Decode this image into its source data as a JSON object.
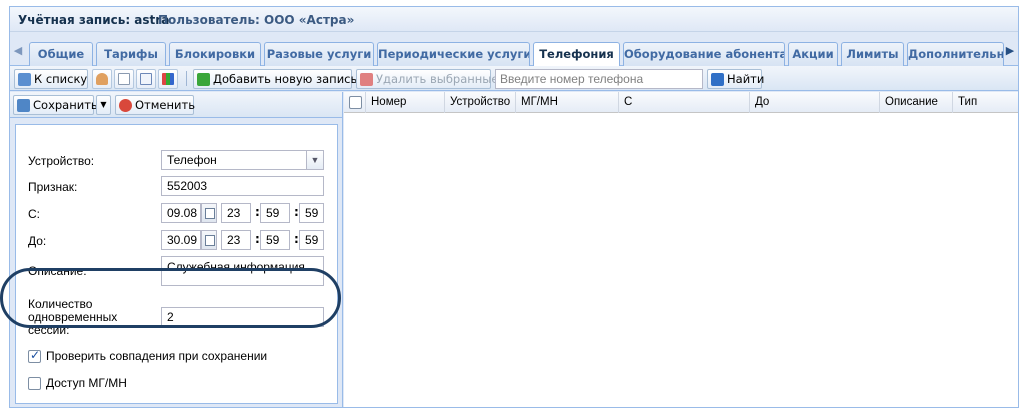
{
  "window": {
    "account_label": "Учётная запись: astra",
    "user_label": "Пользователь: ООО «Астра»"
  },
  "tabs": [
    {
      "label": "Общие",
      "active": false
    },
    {
      "label": "Тарифы",
      "active": false
    },
    {
      "label": "Блокировки",
      "active": false
    },
    {
      "label": "Разовые услуги",
      "active": false
    },
    {
      "label": "Периодические услуги",
      "active": false
    },
    {
      "label": "Телефония",
      "active": true
    },
    {
      "label": "Оборудование абонента",
      "active": false
    },
    {
      "label": "Акции",
      "active": false
    },
    {
      "label": "Лимиты",
      "active": false
    },
    {
      "label": "Дополнительн",
      "active": false
    }
  ],
  "toolbar": {
    "back_label": "К списку",
    "add_label": "Добавить новую запись",
    "delete_label": "Удалить выбранные",
    "search_placeholder": "Введите номер телефона",
    "find_label": "Найти"
  },
  "form_toolbar": {
    "save_label": "Сохранить",
    "cancel_label": "Отменить"
  },
  "form": {
    "device_label": "Устройство:",
    "device_value": "Телефон",
    "sign_label": "Признак:",
    "sign_value": "552003",
    "from_label": "С:",
    "from_date": "09.08",
    "from_hh": "23",
    "from_mm": "59",
    "from_ss": "59",
    "to_label": "До:",
    "to_date": "30.09",
    "to_hh": "23",
    "to_mm": "59",
    "to_ss": "59",
    "desc_label": "Описание:",
    "desc_value": "Служебная информация",
    "sessions_label_1": "Количество",
    "sessions_label_2": "одновременных",
    "sessions_label_3": "сессий:",
    "sessions_value": "2",
    "check_dup_label": "Проверить совпадения при сохранении",
    "check_dup_checked": true,
    "access_label": "Доступ МГ/МН",
    "access_checked": false
  },
  "grid": {
    "columns": [
      "Номер",
      "Устройство",
      "МГ/МН",
      "С",
      "До",
      "Описание",
      "Тип"
    ]
  },
  "colors": {
    "accent_border": "#99bbe8",
    "highlight_ring": "#1f3f64",
    "add_icon": "#3aa63a",
    "delete_icon": "#d9534f",
    "find_icon": "#2f6fc6"
  }
}
